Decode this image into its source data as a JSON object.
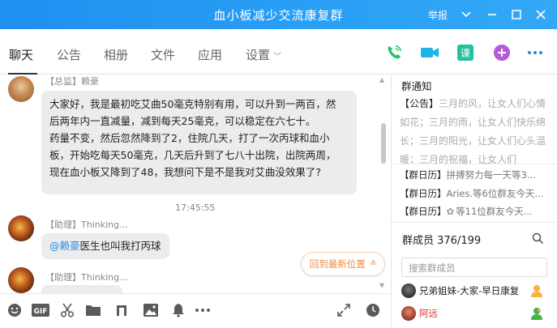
{
  "window": {
    "title": "血小板减少交流康复群",
    "report_label": "举报"
  },
  "tabs": [
    {
      "label": "聊天"
    },
    {
      "label": "公告"
    },
    {
      "label": "相册"
    },
    {
      "label": "文件"
    },
    {
      "label": "应用"
    },
    {
      "label": "设置"
    }
  ],
  "messages": [
    {
      "role": "【总监】",
      "name": "赖豪",
      "lines": [
        "大家好，我是最初吃艾曲50毫克特别有用，可以升到一两百，然",
        "后两年内一直减量，减到每天25毫克，可以稳定在六七十。",
        "药量不变，然后忽然降到了2，住院几天，打了一次丙球和血小",
        "板，开始吃每天50毫克，几天后升到了七八十出院，出院两周，",
        "现在血小板又降到了48，我想问下是不是我对艾曲没效果了?"
      ]
    },
    {
      "role": "【助理】",
      "name": "Thinking...",
      "mention": "@赖豪",
      "text": "医生也叫我打丙球"
    },
    {
      "role": "【助理】",
      "name": "Thinking..."
    }
  ],
  "timestamp": "17:45:55",
  "back_to_latest": "回到最新位置",
  "notice": {
    "title": "群通知",
    "label": "【公告】",
    "faded_text": "三月的风，让女人们心情如花；三月的雨，让女人们快乐绵长；三月的阳光，让女人们心头温暖；三月的祝福，让女人们"
  },
  "calendar": [
    {
      "label": "【群日历】",
      "text": "拼搏努力每一天等3..."
    },
    {
      "label": "【群日历】",
      "text": "Aries.等6位群友今天..."
    },
    {
      "label": "【群日历】",
      "text": "等11位群友今天..."
    }
  ],
  "members": {
    "title": "群成员 376/199",
    "search_placeholder": "搜索群成员",
    "list": [
      {
        "name": "兄弟姐妹-大家-早日康复",
        "color": "#222222"
      },
      {
        "name": "阿远",
        "color": "#e0312c"
      }
    ]
  },
  "colors": {
    "titlebar": "#2a9cf3",
    "phone": "#1fc46b",
    "video": "#1eb3e6",
    "class": "#23c0a0",
    "plus": "#b45bd8",
    "more": "#2a8ae0",
    "back_latest": "#f08a3c"
  }
}
